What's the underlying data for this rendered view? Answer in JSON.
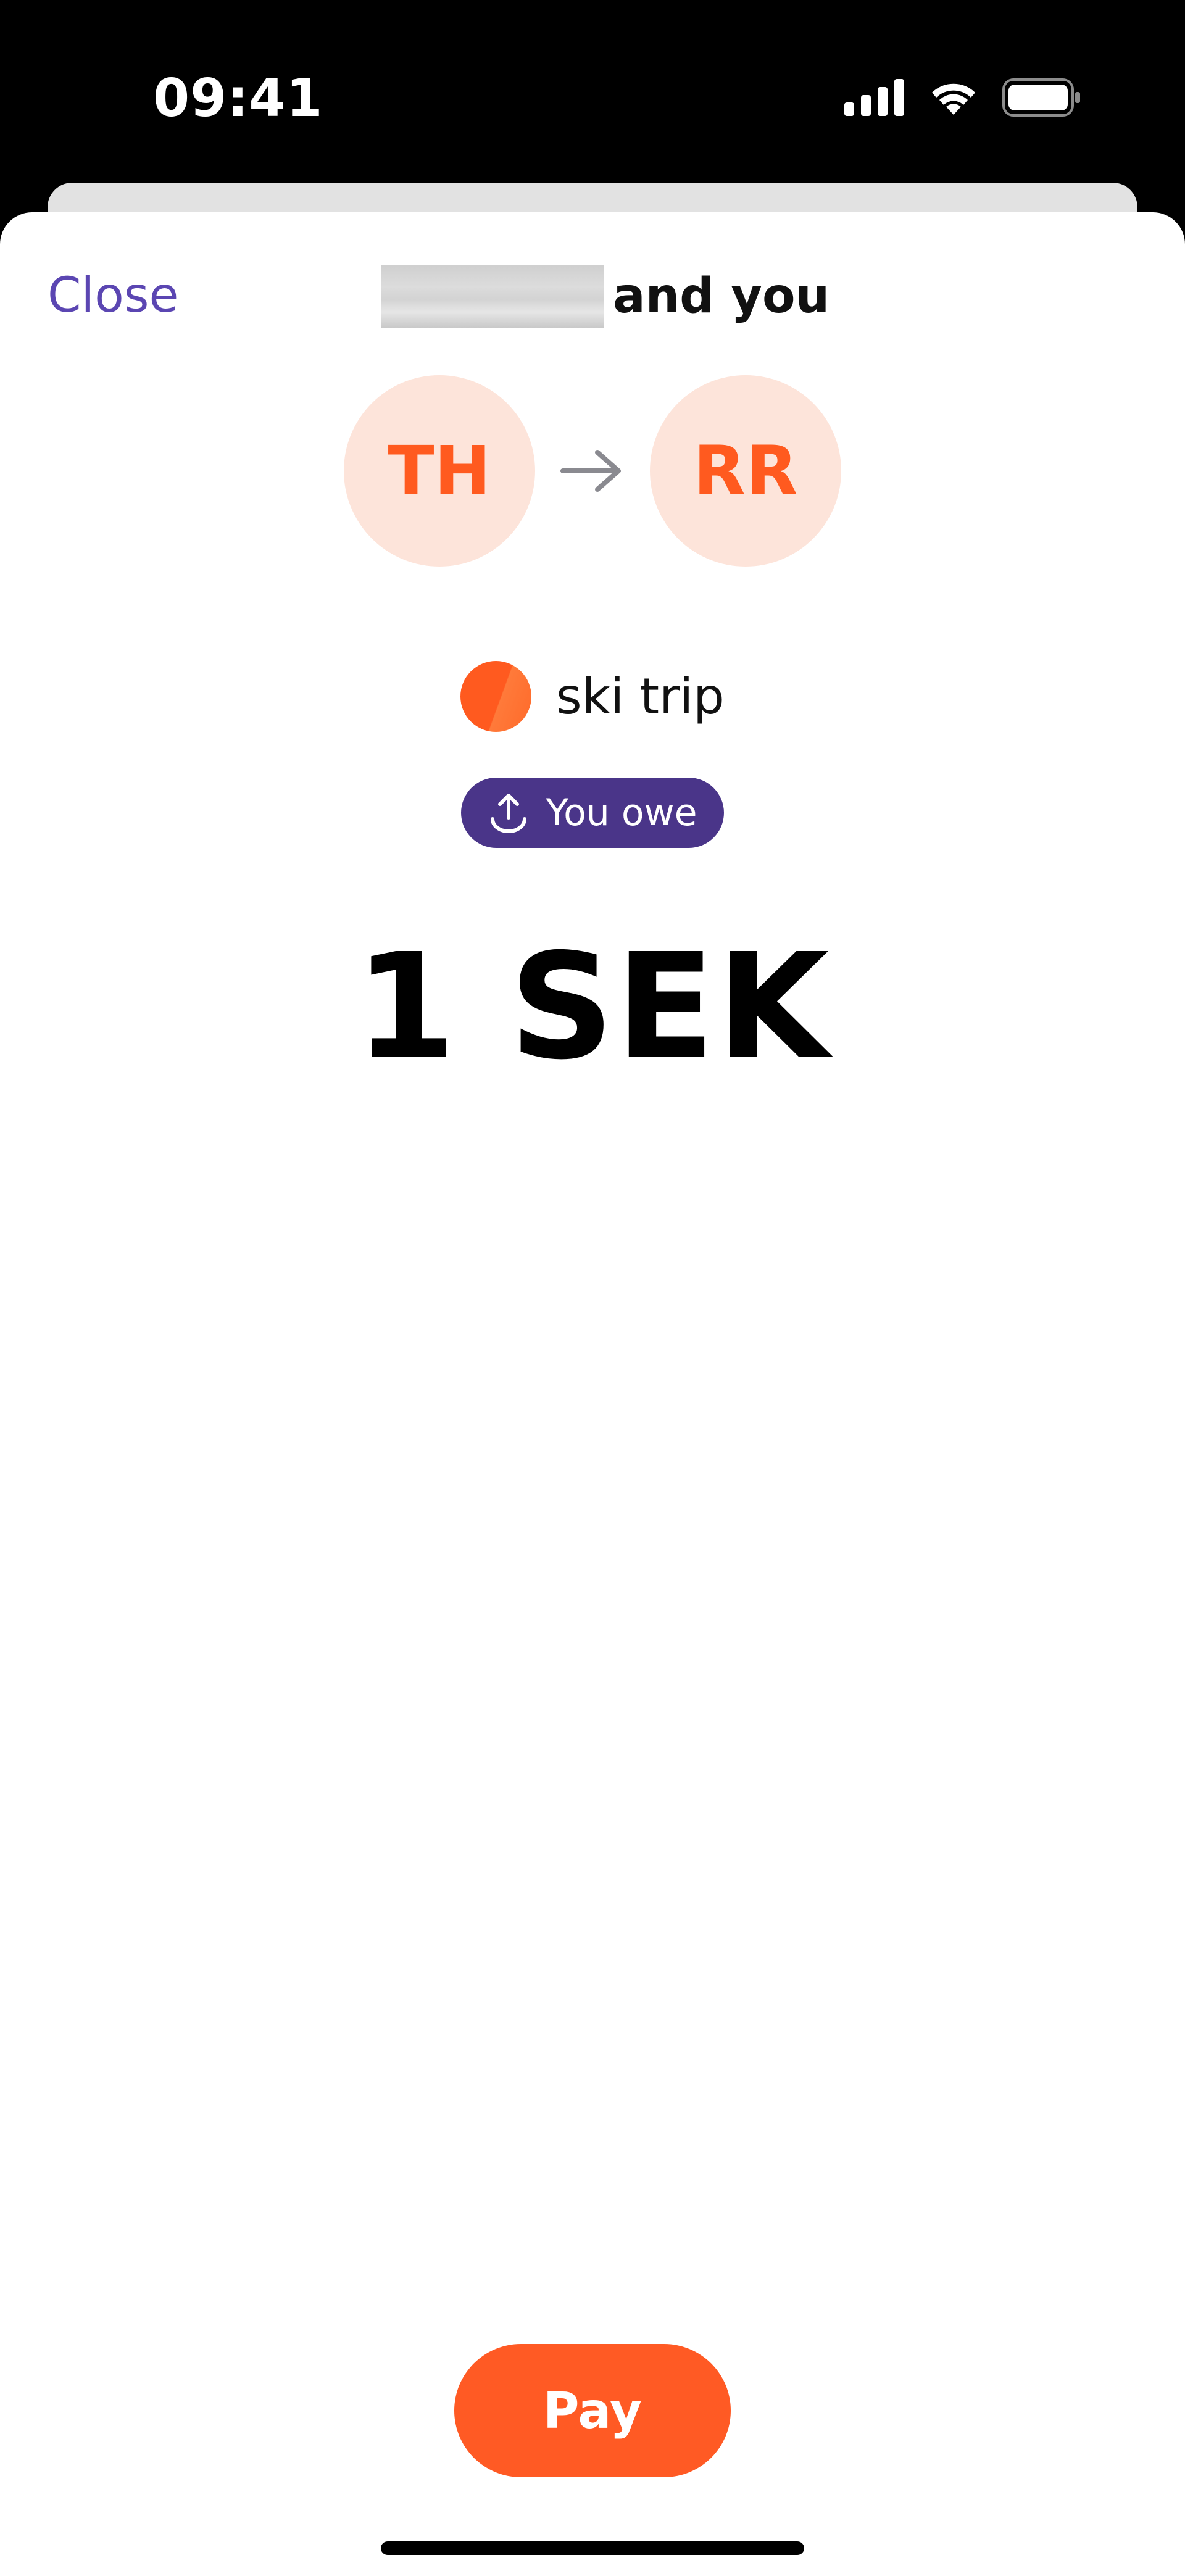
{
  "status_bar": {
    "time": "09:41",
    "icons": [
      "cellular-signal-icon",
      "wifi-icon",
      "battery-icon"
    ]
  },
  "header": {
    "close_label": "Close",
    "title_suffix": "and you"
  },
  "avatars": {
    "from_initials": "TH",
    "to_initials": "RR",
    "arrow_icon": "arrow-right-icon"
  },
  "group": {
    "name": "ski trip",
    "icon": "group-dot-icon"
  },
  "badge": {
    "label": "You owe",
    "icon": "upload-arrow-icon"
  },
  "amount": {
    "text": "1 SEK"
  },
  "actions": {
    "pay_label": "Pay"
  },
  "colors": {
    "accent_orange": "#ff5a24",
    "avatar_bg": "#fde4da",
    "link_purple": "#5b46b2",
    "badge_purple": "#4a3589"
  }
}
